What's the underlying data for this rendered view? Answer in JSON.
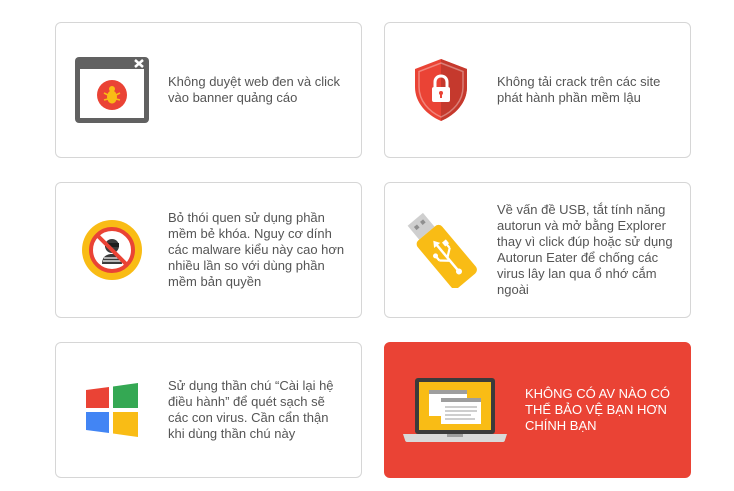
{
  "cards": [
    {
      "text": "Không duyệt web đen và click vào banner quảng cáo",
      "icon": "browser-bug-icon"
    },
    {
      "text": "Không tải crack trên các site phát hành phần mềm lậu",
      "icon": "shield-lock-icon"
    },
    {
      "text": "Bỏ thói quen sử dụng phần mềm bẻ khóa. Nguy cơ dính các malware kiểu này cao hơn nhiều lần so với dùng phần mềm bản quyền",
      "icon": "no-hacker-icon"
    },
    {
      "text": "Về vấn đề USB, tắt tính năng autorun và mở bằng Explorer thay vì click đúp hoặc sử dụng Autorun Eater để chống các virus lây lan qua ổ nhớ cắm ngoài",
      "icon": "usb-drive-icon"
    },
    {
      "text": "Sử dụng thần chú “Cài lại hệ điều hành” để quét sạch sẽ các con virus. Cần cẩn thận khi dùng thần chú này",
      "icon": "windows-logo-icon"
    },
    {
      "text": "KHÔNG CÓ AV NÀO CÓ THỂ BẢO VỆ BẠN HƠN CHÍNH BẠN",
      "icon": "laptop-icon"
    }
  ],
  "colors": {
    "accent_red": "#ea4335",
    "yellow": "#f9bc15",
    "card_border": "#d6d6d6",
    "text_gray": "#555555"
  }
}
